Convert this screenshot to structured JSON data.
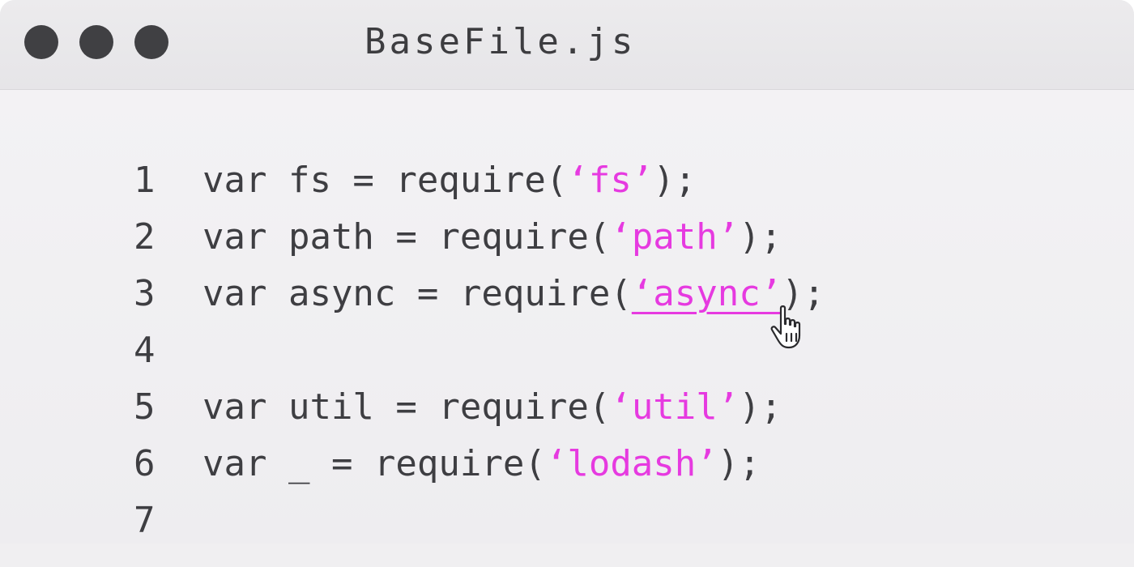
{
  "window": {
    "title": "BaseFile.js"
  },
  "code": {
    "lines": [
      {
        "num": "1",
        "pre": "var fs = require(",
        "str": "‘fs’",
        "post": ");"
      },
      {
        "num": "2",
        "pre": "var path = require(",
        "str": "‘path’",
        "post": ");"
      },
      {
        "num": "3",
        "pre": "var async = require(",
        "str": "‘async’",
        "post": ");"
      },
      {
        "num": "4",
        "pre": "",
        "str": "",
        "post": ""
      },
      {
        "num": "5",
        "pre": "var util = require(",
        "str": "‘util’",
        "post": ");"
      },
      {
        "num": "6",
        "pre": "var _ = require(",
        "str": "‘lodash’",
        "post": ");"
      },
      {
        "num": "7",
        "pre": "",
        "str": "",
        "post": ""
      }
    ]
  },
  "colors": {
    "string": "#e63ae0",
    "text": "#3e3e42",
    "traffic_light": "#404043"
  },
  "icons": {
    "cursor": "hand-pointer-icon"
  }
}
